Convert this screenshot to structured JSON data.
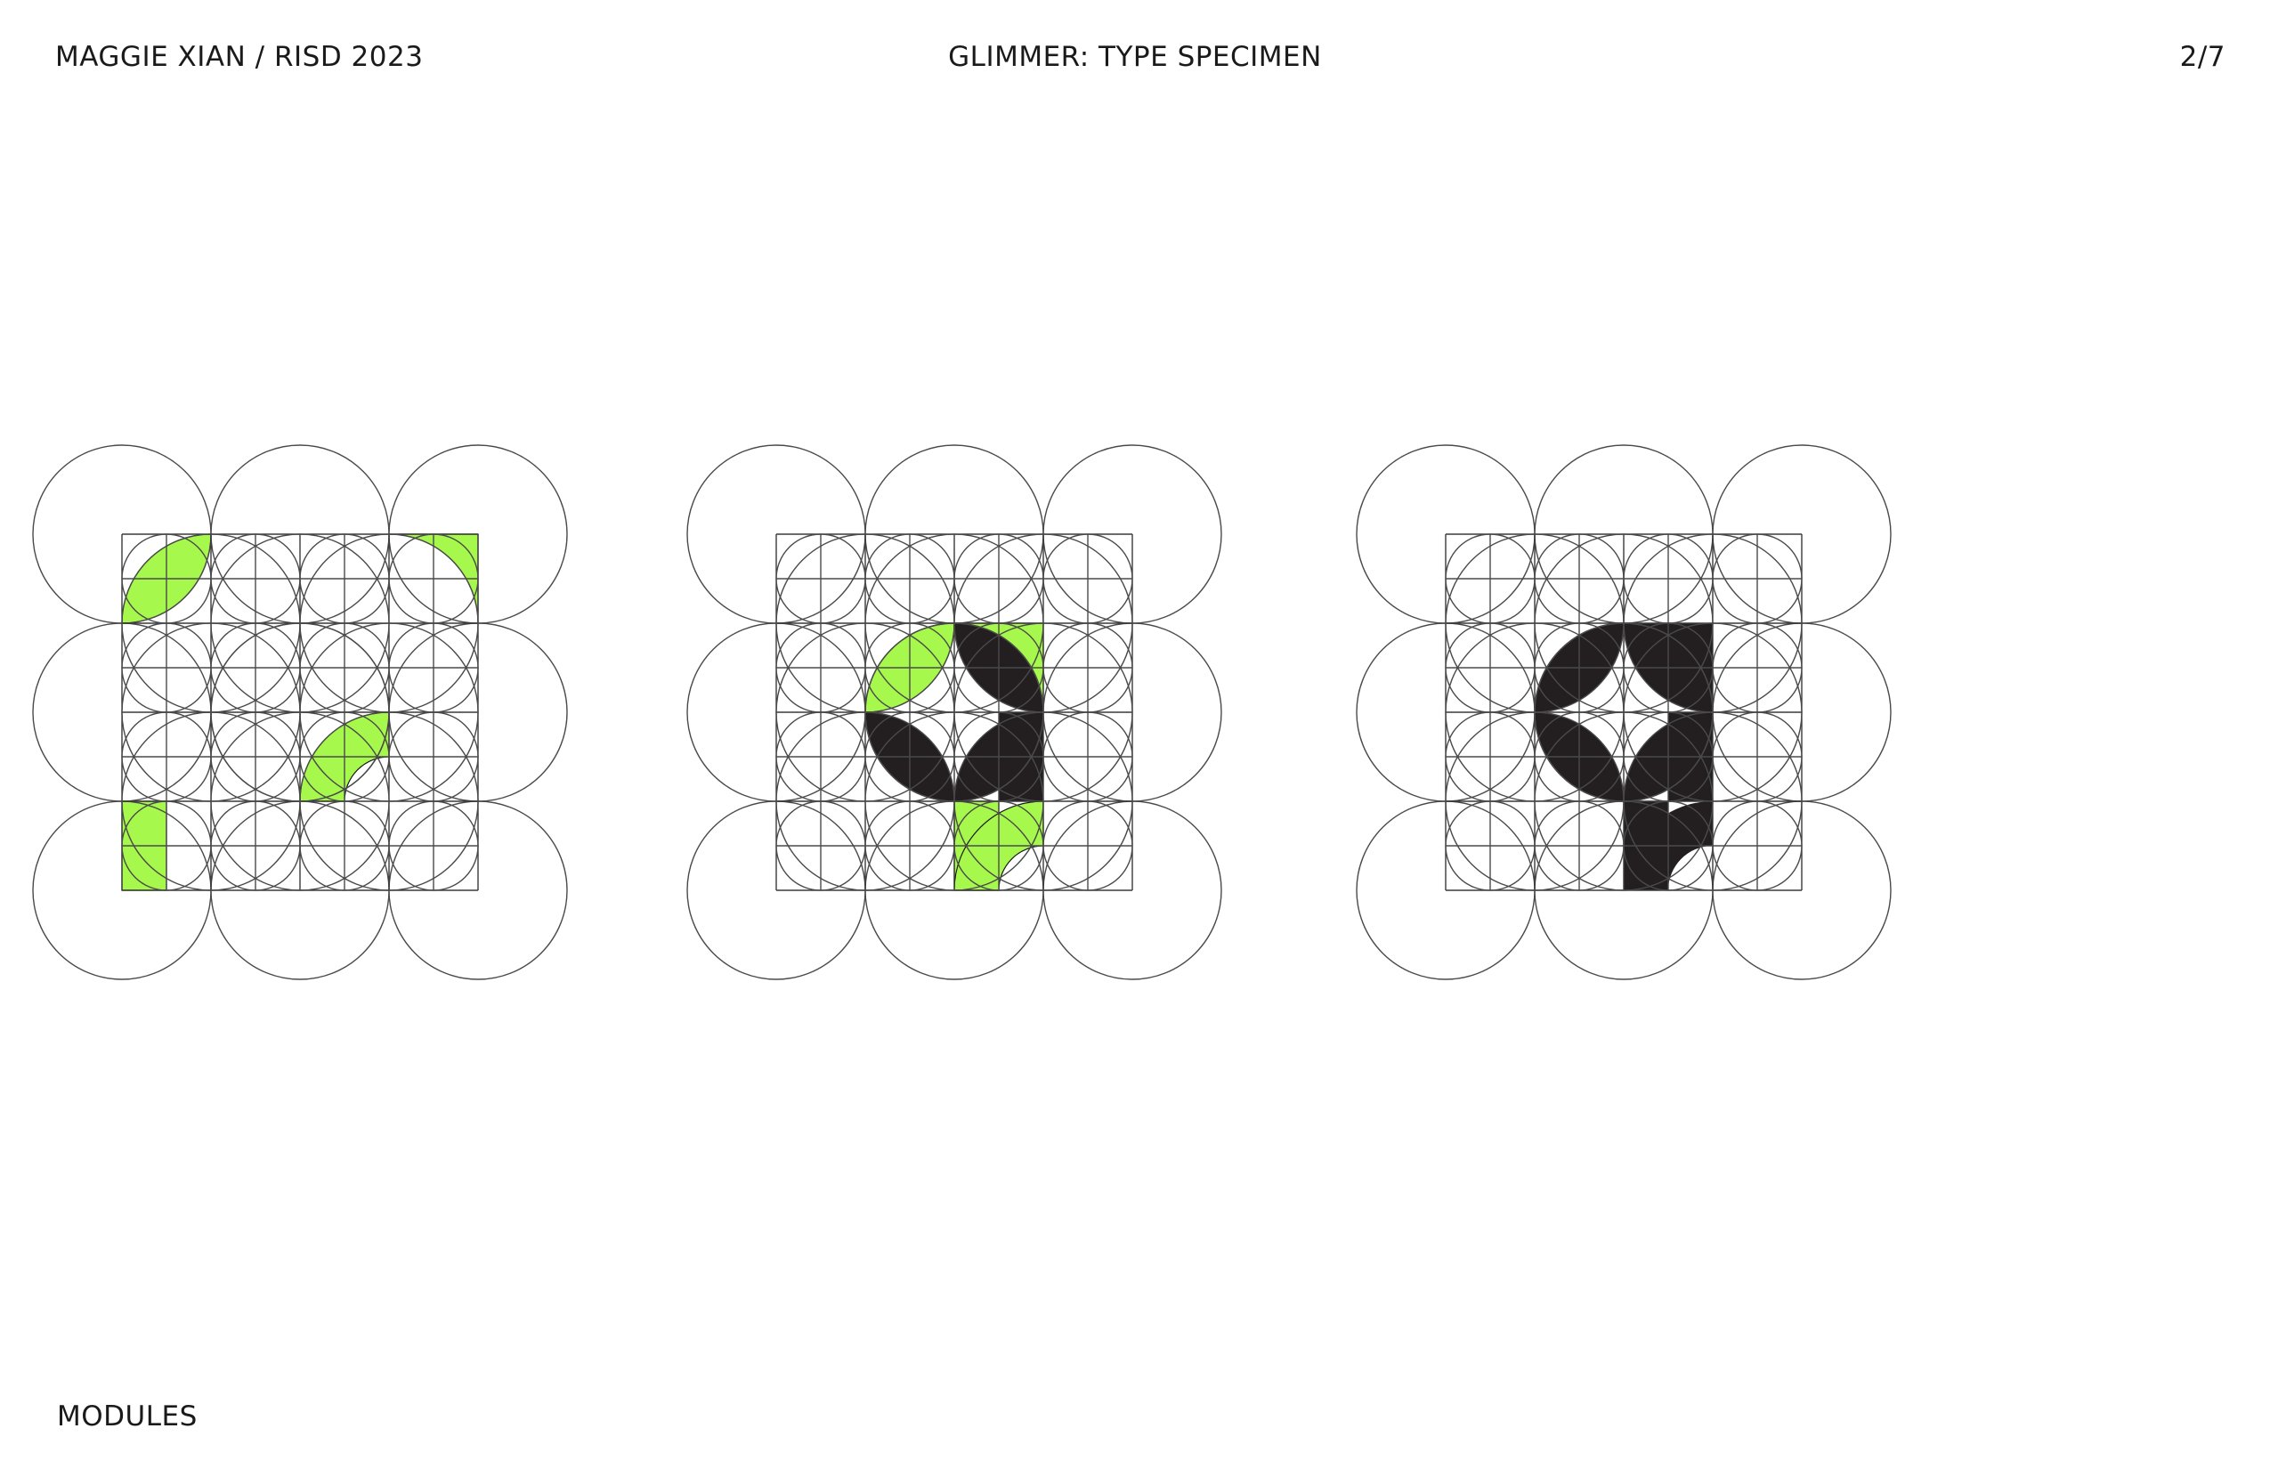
{
  "header": {
    "author": "MAGGIE XIAN / RISD 2023",
    "title": "GLIMMER: TYPE SPECIMEN",
    "page": "2/7"
  },
  "footer": {
    "section": "MODULES"
  },
  "colors": {
    "accent": "#a6f94c",
    "ink": "#231f20",
    "line": "#4a4a4a",
    "background": "#ffffff"
  },
  "figure": {
    "panels": [
      {
        "name": "module-set",
        "modules": [
          {
            "shape": "leaf",
            "col": 0,
            "row": 0,
            "color": "accent"
          },
          {
            "shape": "quarter-corner-tr",
            "col": 3,
            "row": 0,
            "color": "accent"
          },
          {
            "shape": "quarter-ring",
            "col": 2,
            "row": 2,
            "color": "accent"
          },
          {
            "shape": "half-bar",
            "col": 0,
            "row": 3,
            "color": "accent"
          }
        ]
      },
      {
        "name": "assembly",
        "modules": [
          {
            "shape": "leaf",
            "col": 1,
            "row": 1,
            "color": "accent"
          },
          {
            "shape": "quarter-corner-tr",
            "col": 2,
            "row": 1,
            "color": "accent"
          },
          {
            "shape": "leaf-mirror",
            "col": 2,
            "row": 1,
            "color": "ink"
          },
          {
            "shape": "leaf-mirror",
            "col": 1,
            "row": 2,
            "color": "ink"
          },
          {
            "shape": "leaf",
            "col": 2,
            "row": 2,
            "color": "ink"
          },
          {
            "shape": "bar-right",
            "col": 2,
            "row": 2,
            "color": "ink"
          },
          {
            "shape": "half-bar",
            "col": 2,
            "row": 3,
            "color": "accent"
          },
          {
            "shape": "quarter-ring",
            "col": 2,
            "row": 3,
            "color": "accent"
          }
        ]
      },
      {
        "name": "letterform",
        "modules": [
          {
            "shape": "leaf",
            "col": 1,
            "row": 1,
            "color": "ink"
          },
          {
            "shape": "quarter-corner-tr",
            "col": 2,
            "row": 1,
            "color": "ink"
          },
          {
            "shape": "leaf-mirror",
            "col": 2,
            "row": 1,
            "color": "ink"
          },
          {
            "shape": "leaf-mirror",
            "col": 1,
            "row": 2,
            "color": "ink"
          },
          {
            "shape": "leaf",
            "col": 2,
            "row": 2,
            "color": "ink"
          },
          {
            "shape": "bar-right",
            "col": 2,
            "row": 2,
            "color": "ink"
          },
          {
            "shape": "half-bar",
            "col": 2,
            "row": 3,
            "color": "ink"
          },
          {
            "shape": "quarter-ring",
            "col": 2,
            "row": 3,
            "color": "ink"
          }
        ]
      }
    ]
  }
}
